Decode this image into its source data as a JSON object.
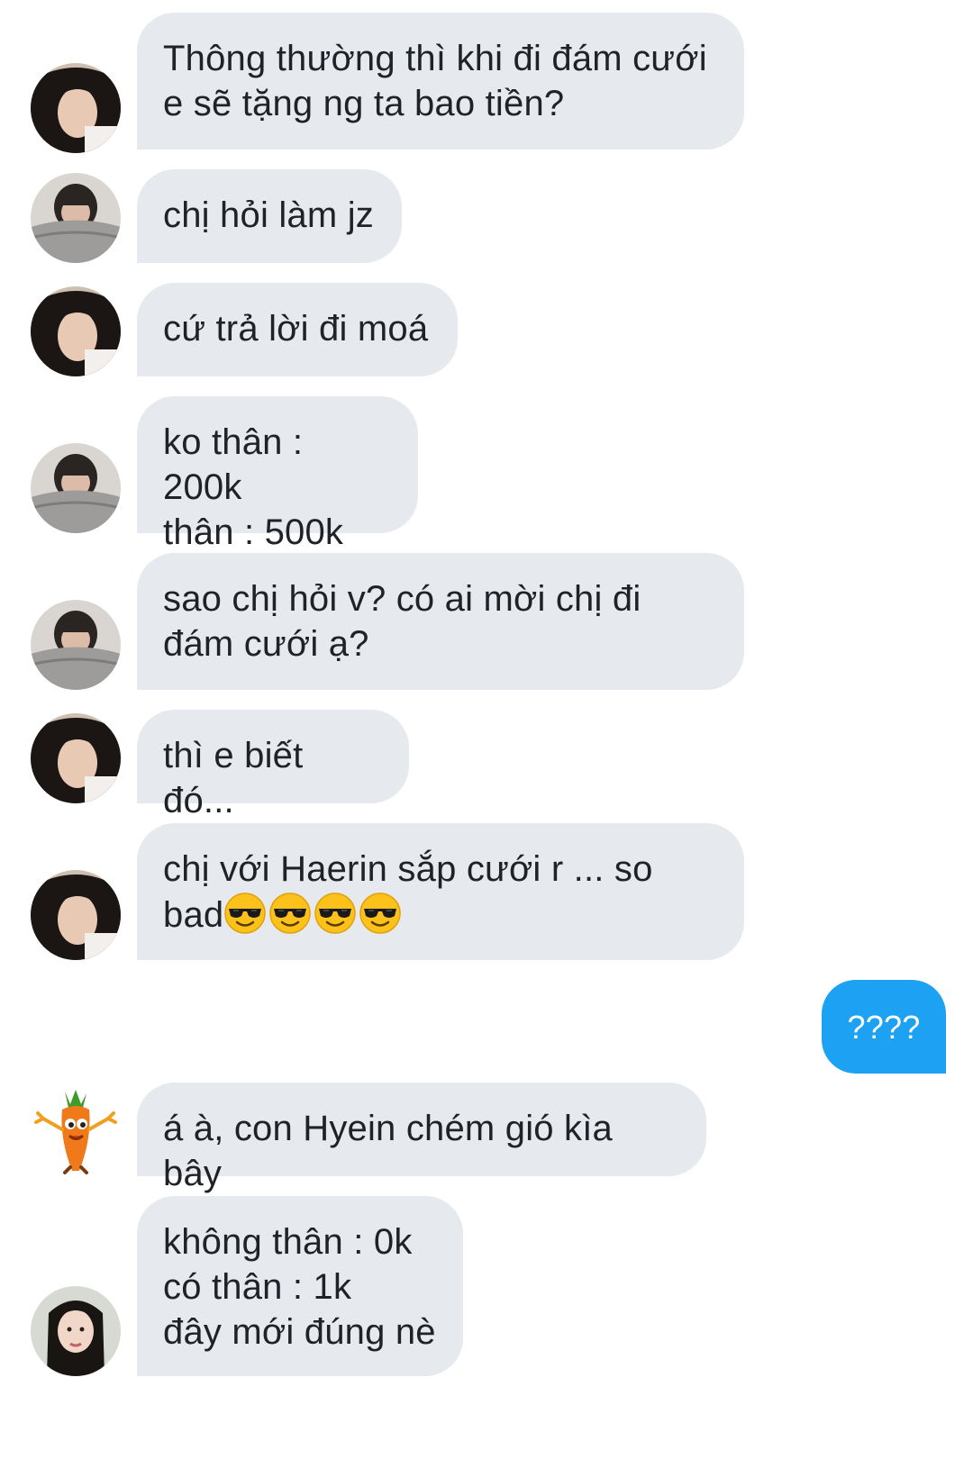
{
  "conversation": {
    "messages": [
      {
        "sender": "profile-a",
        "text": "Thông thường thì khi đi đám cưới\ne sẽ tặng ng ta bao tiền?"
      },
      {
        "sender": "profile-b",
        "text": "chị hỏi làm jz"
      },
      {
        "sender": "profile-a",
        "text": "cứ trả lời đi moá"
      },
      {
        "sender": "profile-b",
        "text": "ko thân : 200k\nthân : 500k"
      },
      {
        "sender": "profile-b",
        "text": "sao chị hỏi v? có ai mời chị đi\nđám cưới ạ?"
      },
      {
        "sender": "profile-a",
        "text": "thì e biết đó..."
      },
      {
        "sender": "profile-a",
        "text": "chị với Haerin sắp cưới r ... so\nbad",
        "emoji": "smiling-face-with-sunglasses",
        "emoji_count": 4
      },
      {
        "sender": "me",
        "text": "????"
      },
      {
        "sender": "carrot",
        "text": "á à, con Hyein chém gió kìa bây"
      },
      {
        "sender": "profile-c",
        "text": "không thân : 0k\ncó thân : 1k\nđây mới đúng nè"
      }
    ]
  },
  "colors": {
    "incoming_bubble": "#e6eaee",
    "outgoing_bubble": "#1da1f2",
    "text": "#1f2328",
    "background": "#ffffff"
  }
}
